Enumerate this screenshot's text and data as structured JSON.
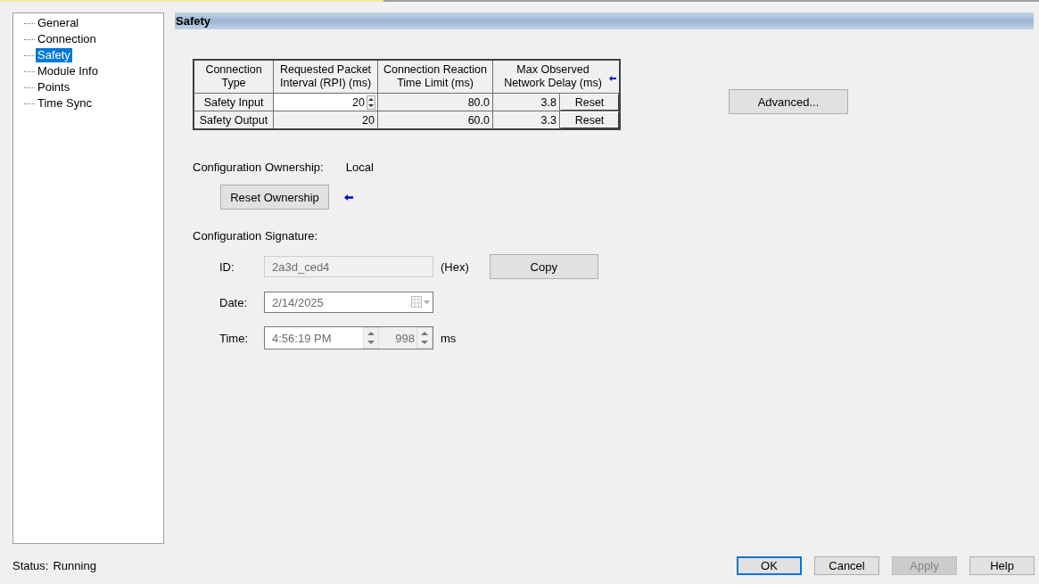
{
  "tree": {
    "items": [
      {
        "label": "General",
        "selected": false
      },
      {
        "label": "Connection",
        "selected": false
      },
      {
        "label": "Safety",
        "selected": true
      },
      {
        "label": "Module Info",
        "selected": false
      },
      {
        "label": "Points",
        "selected": false
      },
      {
        "label": "Time Sync",
        "selected": false
      }
    ]
  },
  "section_title": "Safety",
  "table": {
    "columns": [
      "Connection Type",
      "Requested Packet Interval (RPI) (ms)",
      "Connection Reaction Time Limit (ms)",
      "Max Observed Network Delay (ms)"
    ],
    "rows": [
      {
        "type": "Safety Input",
        "rpi": "20",
        "rpi_editable": true,
        "reaction": "80.0",
        "delay": "3.8",
        "reset": "Reset"
      },
      {
        "type": "Safety Output",
        "rpi": "20",
        "rpi_editable": false,
        "reaction": "60.0",
        "delay": "3.3",
        "reset": "Reset"
      }
    ]
  },
  "advanced_button": "Advanced...",
  "ownership": {
    "label": "Configuration Ownership:",
    "value": "Local",
    "reset_button": "Reset Ownership"
  },
  "signature": {
    "label": "Configuration Signature:",
    "id_label": "ID:",
    "id_value": "2a3d_ced4",
    "id_unit": "(Hex)",
    "copy_button": "Copy",
    "date_label": "Date:",
    "date_value": "2/14/2025",
    "time_label": "Time:",
    "time_value": "4:56:19 PM",
    "ms_value": "998",
    "ms_unit": "ms"
  },
  "status_bar": {
    "label": "Status:",
    "value": "Running"
  },
  "buttons": [
    {
      "label": "OK",
      "default": true,
      "disabled": false
    },
    {
      "label": "Cancel",
      "default": false,
      "disabled": false
    },
    {
      "label": "Apply",
      "default": false,
      "disabled": true
    },
    {
      "label": "Help",
      "default": false,
      "disabled": false
    }
  ]
}
